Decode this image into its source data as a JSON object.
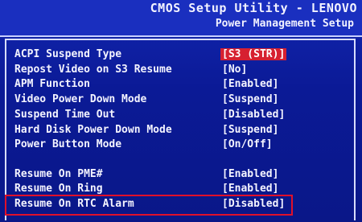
{
  "header": {
    "app_title": "CMOS Setup Utility - LENOVO",
    "page_title": "Power Management Setup"
  },
  "settings": [
    {
      "label": "ACPI Suspend Type",
      "value": "[S3 (STR)]"
    },
    {
      "label": "Repost Video on S3 Resume",
      "value": "[No]"
    },
    {
      "label": "APM Function",
      "value": "[Enabled]"
    },
    {
      "label": "Video Power Down Mode",
      "value": "[Suspend]"
    },
    {
      "label": "Suspend Time Out",
      "value": "[Disabled]"
    },
    {
      "label": "Hard Disk Power Down Mode",
      "value": "[Suspend]"
    },
    {
      "label": "Power Button Mode",
      "value": "[On/Off]"
    },
    {
      "label": "Resume On PME#",
      "value": "[Enabled]"
    },
    {
      "label": "Resume On Ring",
      "value": "[Enabled]"
    },
    {
      "label": "Resume On RTC Alarm",
      "value": "[Disabled]"
    }
  ],
  "colors": {
    "background": "#0a1a8c",
    "selected_value_bg": "#d62030",
    "annotation_box": "#e0102a",
    "text": "#f4f4ff"
  }
}
